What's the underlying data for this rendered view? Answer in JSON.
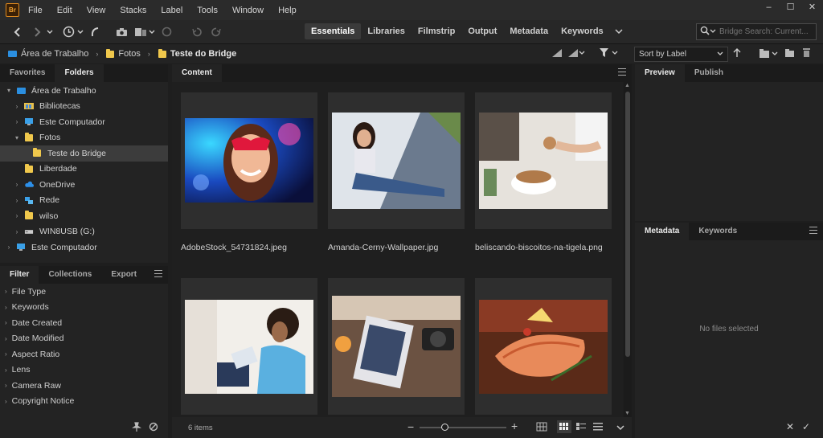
{
  "app": {
    "logo_text": "Br"
  },
  "menu": [
    "File",
    "Edit",
    "View",
    "Stacks",
    "Label",
    "Tools",
    "Window",
    "Help"
  ],
  "window_controls": {
    "minimize": "–",
    "maximize": "☐",
    "close": "✕"
  },
  "workspaces": [
    {
      "label": "Essentials",
      "active": true
    },
    {
      "label": "Libraries",
      "active": false
    },
    {
      "label": "Filmstrip",
      "active": false
    },
    {
      "label": "Output",
      "active": false
    },
    {
      "label": "Metadata",
      "active": false
    },
    {
      "label": "Keywords",
      "active": false
    }
  ],
  "search": {
    "placeholder": "Bridge Search: Current..."
  },
  "breadcrumb": [
    "Área de Trabalho",
    "Fotos",
    "Teste do Bridge"
  ],
  "sort": {
    "label": "Sort by Label"
  },
  "left_top_tabs": [
    "Favorites",
    "Folders"
  ],
  "folder_tree": [
    {
      "label": "Área de Trabalho",
      "depth": 0,
      "arrow": "▾",
      "icon": "desktop-icon"
    },
    {
      "label": "Bibliotecas",
      "depth": 1,
      "arrow": "›",
      "icon": "libraries-icon"
    },
    {
      "label": "Este Computador",
      "depth": 1,
      "arrow": "›",
      "icon": "computer-icon"
    },
    {
      "label": "Fotos",
      "depth": 1,
      "arrow": "▾",
      "icon": "folder-icon"
    },
    {
      "label": "Teste do Bridge",
      "depth": 2,
      "arrow": "",
      "icon": "folder-icon",
      "selected": true
    },
    {
      "label": "Liberdade",
      "depth": 1,
      "arrow": "",
      "icon": "folder-icon"
    },
    {
      "label": "OneDrive",
      "depth": 1,
      "arrow": "›",
      "icon": "onedrive-icon"
    },
    {
      "label": "Rede",
      "depth": 1,
      "arrow": "›",
      "icon": "network-icon"
    },
    {
      "label": "wilso",
      "depth": 1,
      "arrow": "›",
      "icon": "folder-icon"
    },
    {
      "label": "WIN8USB (G:)",
      "depth": 1,
      "arrow": "›",
      "icon": "usb-drive-icon"
    },
    {
      "label": "Este Computador",
      "depth": 0,
      "arrow": "›",
      "icon": "computer-icon"
    }
  ],
  "left_bottom_tabs": [
    "Filter",
    "Collections",
    "Export"
  ],
  "filters": [
    "File Type",
    "Keywords",
    "Date Created",
    "Date Modified",
    "Aspect Ratio",
    "Lens",
    "Camera Raw",
    "Copyright Notice"
  ],
  "content": {
    "tab": "Content",
    "items": [
      {
        "name": "AdobeStock_54731824.jpeg",
        "palette": [
          "#0d1a5a",
          "#2a8cff",
          "#ff3aa0",
          "#f2b0a0"
        ]
      },
      {
        "name": "Amanda-Cerny-Wallpaper.jpg",
        "palette": [
          "#dfe4ea",
          "#6d7d92",
          "#2e3a55",
          "#c9a88a"
        ]
      },
      {
        "name": "beliscando-biscoitos-na-tigela.png",
        "palette": [
          "#e9e6e1",
          "#c89b6b",
          "#7a5a3a",
          "#ffffff"
        ]
      },
      {
        "name": "",
        "palette": [
          "#f4f1ec",
          "#5ab0e0",
          "#3a2a20",
          "#b08060"
        ]
      },
      {
        "name": "",
        "palette": [
          "#6b5242",
          "#d8c8b8",
          "#2a2a2a",
          "#8a6b4a"
        ]
      },
      {
        "name": "",
        "palette": [
          "#7a3a20",
          "#e68a5a",
          "#f5d070",
          "#3a5a2a"
        ]
      }
    ],
    "count_label": "6 items"
  },
  "right_top_tabs": [
    "Preview",
    "Publish"
  ],
  "right_bottom_tabs": [
    "Metadata",
    "Keywords"
  ],
  "metadata_empty": "No files selected",
  "colors": {
    "accent_folder": "#f0c84c",
    "desktop_blue": "#2b8fe0",
    "bg": "#1e1e1e"
  }
}
